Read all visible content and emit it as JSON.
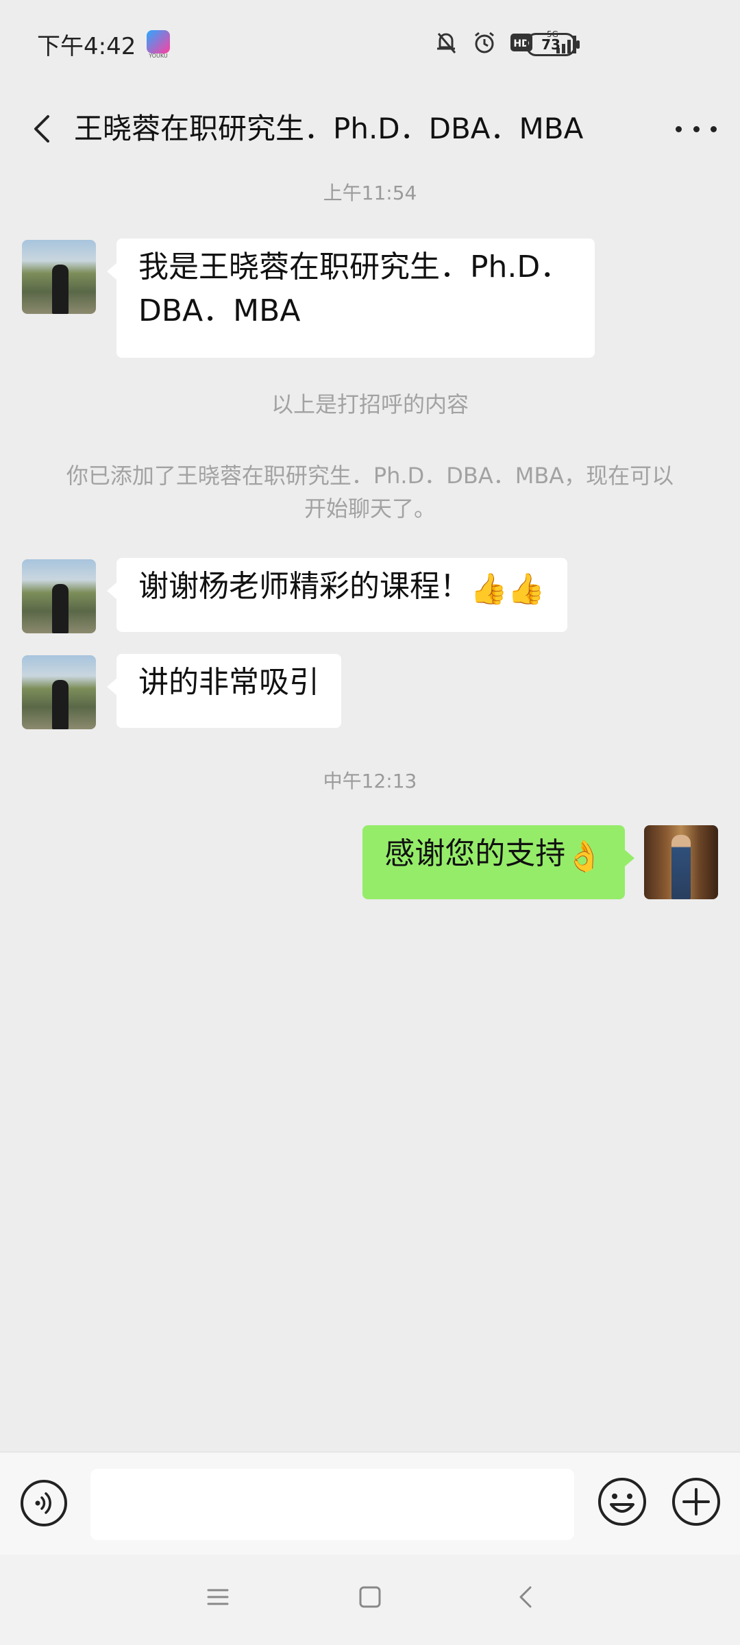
{
  "status_bar": {
    "time": "下午4:42",
    "app_badge": "YOUKU",
    "network": "5G",
    "battery": "73"
  },
  "header": {
    "title": "王晓蓉在职研究生．Ph.D．DBA．MBA"
  },
  "chat": {
    "timestamp_1": "上午11:54",
    "messages": [
      {
        "side": "in",
        "text": "我是王晓蓉在职研究生．Ph.D．DBA．MBA"
      },
      {
        "side": "in",
        "text": "谢谢杨老师精彩的课程！",
        "emoji": "👍👍"
      },
      {
        "side": "in",
        "text": "讲的非常吸引"
      },
      {
        "side": "out",
        "text": "感谢您的支持",
        "emoji": "👌"
      }
    ],
    "system_1": "以上是打招呼的内容",
    "system_2": "你已添加了王晓蓉在职研究生．Ph.D．DBA．MBA，现在可以开始聊天了。",
    "timestamp_2": "中午12:13"
  },
  "input": {
    "value": "",
    "placeholder": ""
  },
  "icons": {
    "back": "chevron-left-icon",
    "more": "more-dots-icon",
    "voice": "voice-icon",
    "emoji": "smiley-icon",
    "plus": "plus-icon"
  },
  "colors": {
    "background": "#ededed",
    "outgoing_bubble": "#95ec69",
    "incoming_bubble": "#ffffff",
    "system_text": "#a2a2a2"
  }
}
